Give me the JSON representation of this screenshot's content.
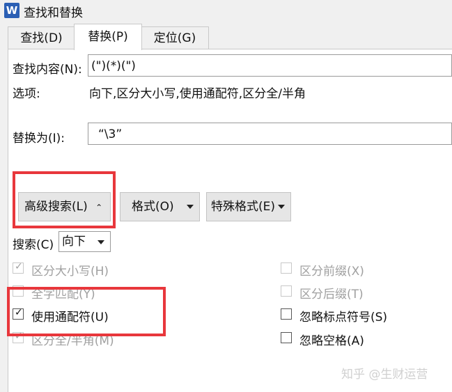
{
  "window": {
    "app_icon_letter": "W",
    "title": "查找和替换"
  },
  "tabs": [
    {
      "label": "查找(D)"
    },
    {
      "label": "替换(P)"
    },
    {
      "label": "定位(G)"
    }
  ],
  "find": {
    "label": "查找内容(N):",
    "value": "(\")(*)(\")"
  },
  "options": {
    "label": "选项:",
    "value": "向下,区分大小写,使用通配符,区分全/半角"
  },
  "replace": {
    "label": "替换为(I):",
    "value": "“\\3”"
  },
  "buttons": {
    "advanced_search": "高级搜索(L)",
    "advanced_search_arrow": "⌃",
    "format": "格式(O)",
    "special_format": "特殊格式(E)"
  },
  "search": {
    "label": "搜索(C)",
    "selected": "向下"
  },
  "checkboxes_left": [
    {
      "label": "区分大小写(H)",
      "checked": true,
      "disabled": true
    },
    {
      "label": "全字匹配(Y)",
      "checked": false,
      "disabled": true
    },
    {
      "label": "使用通配符(U)",
      "checked": true,
      "disabled": false
    },
    {
      "label": "区分全/半角(M)",
      "checked": true,
      "disabled": true
    }
  ],
  "checkboxes_right": [
    {
      "label": "区分前缀(X)",
      "checked": false,
      "disabled": true
    },
    {
      "label": "区分后缀(T)",
      "checked": false,
      "disabled": true
    },
    {
      "label": "忽略标点符号(S)",
      "checked": false,
      "disabled": false
    },
    {
      "label": "忽略空格(A)",
      "checked": false,
      "disabled": false
    }
  ],
  "watermark": "知乎 @生财运营",
  "colors": {
    "highlight_box": "#e8373c",
    "app_icon": "#2b5fb4"
  }
}
